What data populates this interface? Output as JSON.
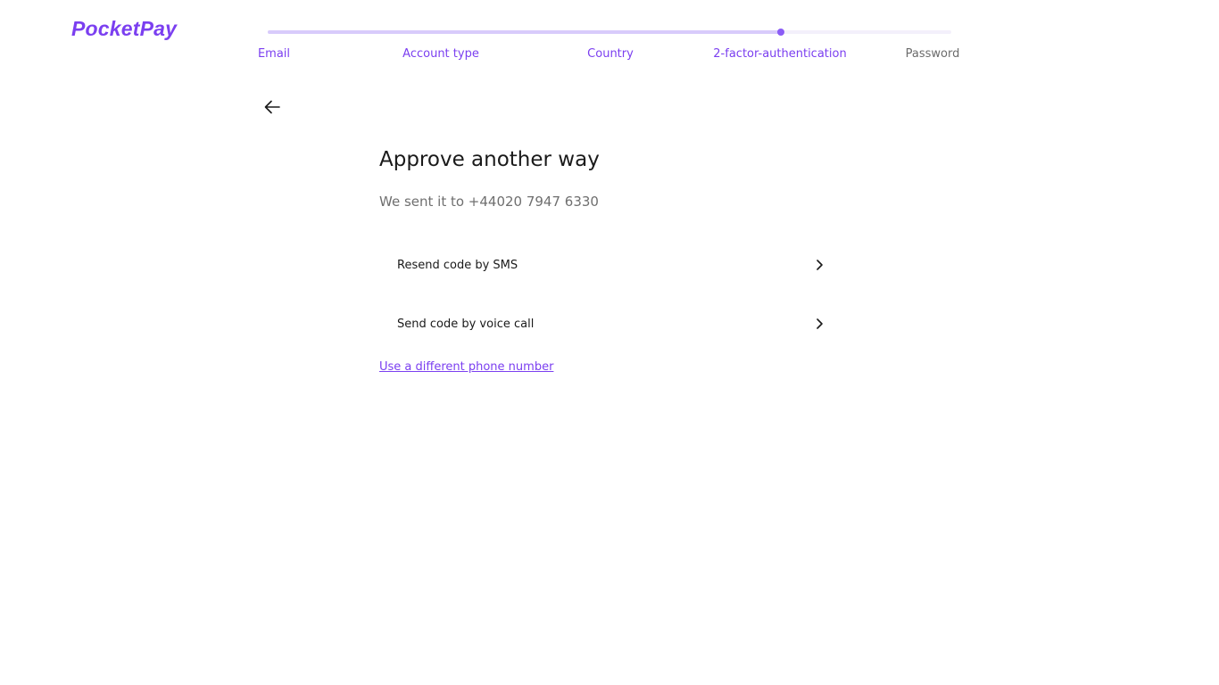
{
  "app": {
    "logo_text": "PocketPay",
    "brand_color": "#7b3ff0"
  },
  "progress": {
    "steps": [
      {
        "label": "Email",
        "state": "done"
      },
      {
        "label": "Account type",
        "state": "done"
      },
      {
        "label": "Country",
        "state": "done"
      },
      {
        "label": "2-factor-authentication",
        "state": "current"
      },
      {
        "label": "Password",
        "state": "pending"
      }
    ],
    "completed_fraction": 0.75
  },
  "header": {
    "back_icon": "arrow-left-icon"
  },
  "main": {
    "title": "Approve another way",
    "subtitle": "We sent it to +44020 7947 6330",
    "options": [
      {
        "label": "Resend code by SMS",
        "icon": "chevron-right-icon"
      },
      {
        "label": "Send code by voice call",
        "icon": "chevron-right-icon"
      }
    ],
    "different_number_link": "Use a different phone number"
  }
}
